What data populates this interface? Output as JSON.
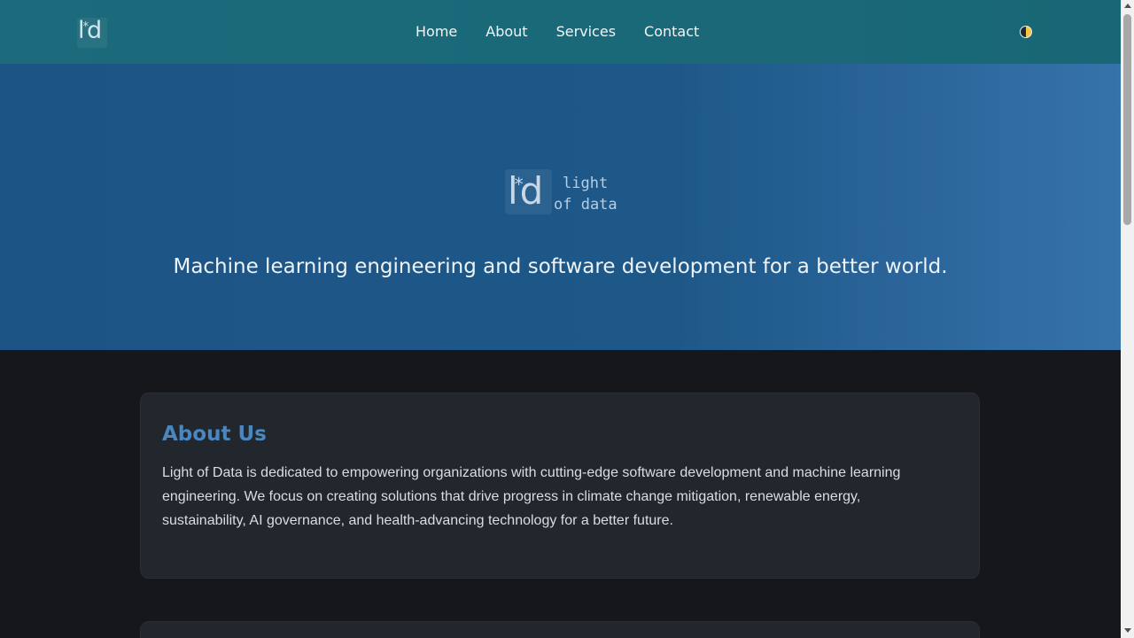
{
  "nav": {
    "logo": {
      "left": "l",
      "star": "*",
      "right": "d"
    },
    "links": [
      "Home",
      "About",
      "Services",
      "Contact"
    ],
    "theme_toggle_icon": "half-circle-icon"
  },
  "hero": {
    "logo": {
      "left": "l",
      "star": "*",
      "right": "d",
      "line1": "light",
      "line2": "of data"
    },
    "tagline": "Machine learning engineering and software development for a better world."
  },
  "about": {
    "title": "About Us",
    "text": "Light of Data is dedicated to empowering organizations with cutting-edge software development and machine learning engineering. We focus on creating solutions that drive progress in climate change mitigation, renewable energy, sustainability, AI governance, and health-advancing technology for a better future."
  },
  "colors": {
    "navbar": "#1b6b7c",
    "hero": "#1d5486",
    "background": "#15171b",
    "card": "#22262d",
    "accent": "#4a86c0"
  }
}
